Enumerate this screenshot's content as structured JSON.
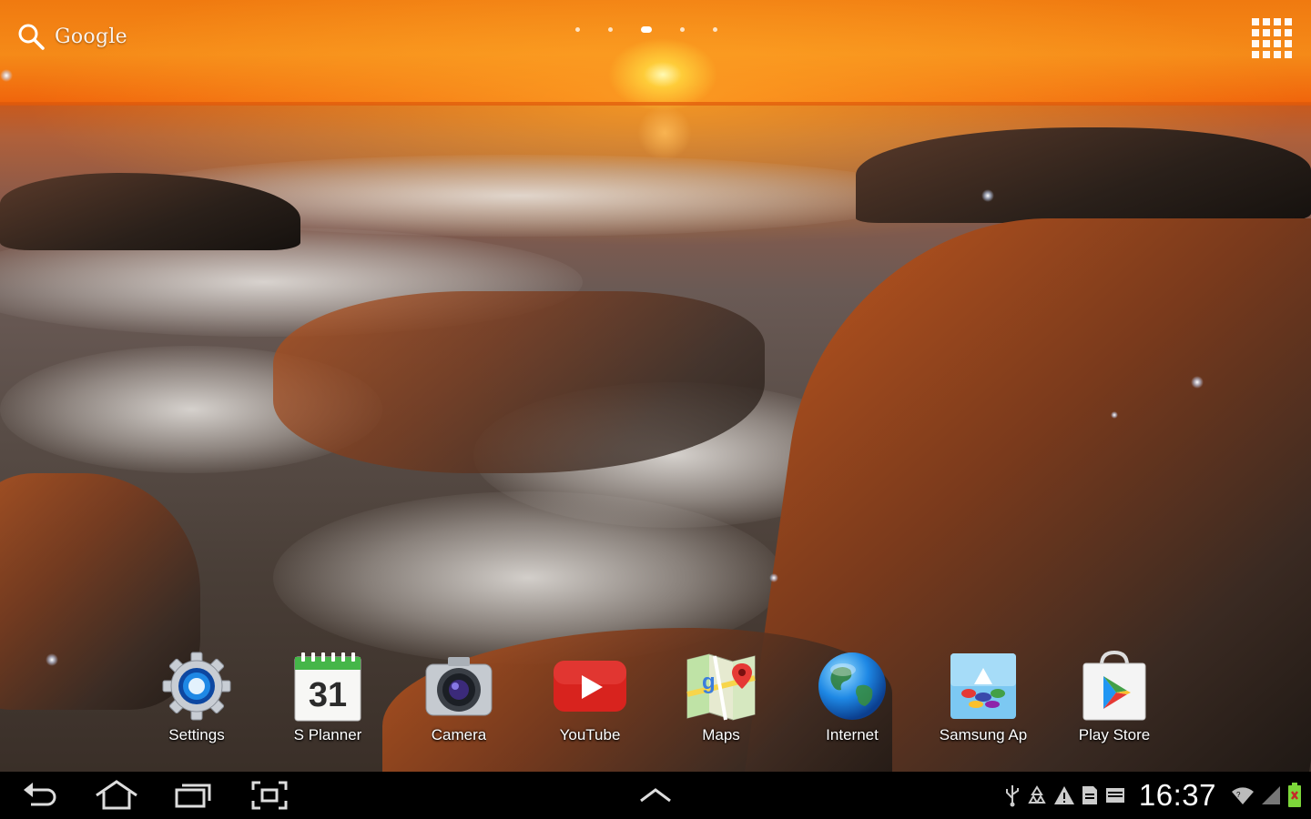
{
  "search": {
    "label": "Google",
    "icon": "search-icon"
  },
  "home_pages": {
    "count": 5,
    "active_index": 2
  },
  "apps_button": {
    "icon": "apps-grid-icon"
  },
  "dock": {
    "apps": [
      {
        "label": "Settings",
        "icon": "settings-gear-icon"
      },
      {
        "label": "S Planner",
        "icon": "calendar-icon",
        "date_number": "31"
      },
      {
        "label": "Camera",
        "icon": "camera-icon"
      },
      {
        "label": "YouTube",
        "icon": "youtube-icon"
      },
      {
        "label": "Maps",
        "icon": "maps-icon"
      },
      {
        "label": "Internet",
        "icon": "globe-icon"
      },
      {
        "label": "Samsung Ap",
        "icon": "samsung-apps-icon"
      },
      {
        "label": "Play Store",
        "icon": "play-store-icon"
      }
    ]
  },
  "navbar": {
    "buttons": [
      "back-icon",
      "home-icon",
      "recent-apps-icon",
      "screenshot-icon",
      "up-arrow-icon"
    ]
  },
  "status": {
    "time": "16:37",
    "icons": [
      "usb-icon",
      "recycle-icon",
      "warning-icon",
      "sd-card-icon",
      "screen-icon",
      "wifi-icon",
      "signal-icon",
      "battery-charging-icon"
    ]
  },
  "colors": {
    "sky": "#f07a10",
    "youtube_red": "#d8231e",
    "settings_blue": "#1565c0",
    "calendar_green": "#3cb043",
    "battery_green": "#7cd63a"
  }
}
